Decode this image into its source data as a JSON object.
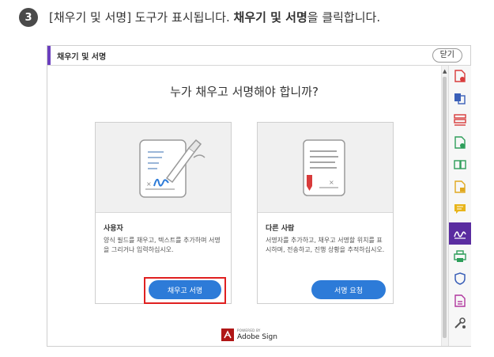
{
  "step": {
    "number": "3",
    "text_prefix": "[채우기 및 서명] 도구가 표시됩니다. ",
    "text_bold": "채우기 및 서명",
    "text_suffix": "을 클릭합니다."
  },
  "toolbar": {
    "title": "채우기 및 서명",
    "close_label": "닫기"
  },
  "main": {
    "question": "누가 채우고 서명해야 합니까?",
    "cards": [
      {
        "heading": "사용자",
        "description": "양식 필드를 채우고, 텍스트를 추가하며 서명을 그리거나 입력하십시오.",
        "button_label": "채우고 서명"
      },
      {
        "heading": "다른 사람",
        "description": "서명자를 추가하고, 채우고 서명할 위치를 표시하며, 전송하고, 진행 상황을 추적하십시오.",
        "button_label": "서명 요청"
      }
    ],
    "brand": {
      "powered_by": "POWERED BY",
      "name": "Adobe Sign"
    }
  },
  "colors": {
    "accent_purple": "#6b3fbf",
    "button_blue": "#2d7bd8",
    "highlight_red": "#e02020",
    "brand_red": "#b01616"
  },
  "right_rail": {
    "icons": [
      "create-pdf-icon",
      "combine-files-icon",
      "organize-pages-icon",
      "edit-pdf-icon",
      "export-pdf-icon",
      "create-pdf-form-icon",
      "comment-icon",
      "fill-sign-icon",
      "print-production-icon",
      "protect-icon",
      "send-for-review-icon",
      "more-tools-icon"
    ]
  }
}
